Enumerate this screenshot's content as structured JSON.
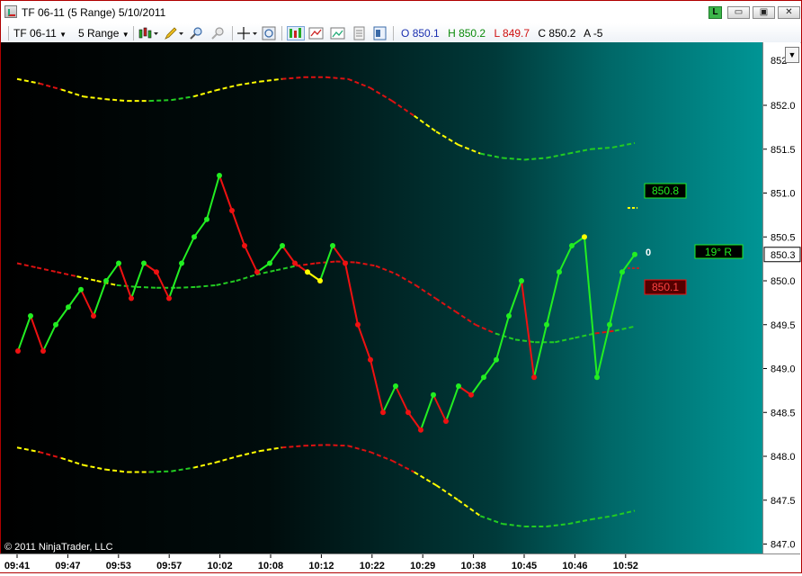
{
  "window": {
    "title": "TF 06-11 (5 Range)  5/10/2011",
    "link_label": "L",
    "minimize_glyph": "▭",
    "maximize_glyph": "▣",
    "close_glyph": "✕"
  },
  "toolbar": {
    "instrument": "TF 06-11",
    "period": "5 Range",
    "ohlc": {
      "open_label": "O",
      "open_value": "850.1",
      "high_label": "H",
      "high_value": "850.2",
      "low_label": "L",
      "low_value": "849.7",
      "close_label": "C",
      "close_value": "850.2",
      "ask_label": "A",
      "ask_value": "-5"
    },
    "icons": [
      "bar-type-icon",
      "drawing-pencil-icon",
      "zoom-in-icon",
      "zoom-out-icon",
      "crosshair-icon",
      "search-icon",
      "chart-trader-icon",
      "indicators-icon",
      "strategies-icon",
      "data-box-icon",
      "properties-icon"
    ]
  },
  "colors": {
    "up": "#22ee22",
    "down": "#ee1111",
    "neutral": "#ffff00",
    "band_up": "#22cc22",
    "band_down": "#dd1111",
    "background_left": "#000000",
    "background_right": "#008b8b"
  },
  "chart": {
    "copyright": "© 2011 NinjaTrader, LLC",
    "price_ticks": [
      "852.0",
      "851.5",
      "851.0",
      "850.5",
      "850.0",
      "849.5",
      "849.0",
      "848.5",
      "848.0",
      "847.5",
      "847.0"
    ],
    "time_ticks": [
      "09:41",
      "09:47",
      "09:53",
      "09:57",
      "10:02",
      "10:08",
      "10:12",
      "10:22",
      "10:29",
      "10:38",
      "10:45",
      "10:46",
      "10:52"
    ],
    "current_price_label": "850.3",
    "label_upper": "850.8",
    "label_lower": "850.1",
    "angle_label": "19°  R",
    "zero_label": "0",
    "top_tick_partial": "852"
  },
  "chart_data": {
    "type": "line",
    "title": "",
    "price_range": [
      846.95,
      852.5
    ],
    "closes": [
      849.2,
      849.6,
      849.2,
      849.5,
      849.7,
      849.9,
      849.6,
      850.0,
      850.2,
      849.8,
      850.2,
      850.1,
      849.8,
      850.2,
      850.5,
      850.7,
      851.2,
      850.8,
      850.4,
      850.1,
      850.2,
      850.4,
      850.2,
      850.1,
      850.0,
      850.4,
      850.2,
      849.5,
      849.1,
      848.5,
      848.8,
      848.5,
      848.3,
      848.7,
      848.4,
      848.8,
      848.7,
      848.9,
      849.1,
      849.6,
      850.0,
      848.9,
      849.5,
      850.1,
      850.4,
      850.5,
      848.9,
      849.5,
      850.1,
      850.3
    ],
    "close_colors": [
      "down",
      "up",
      "down",
      "up",
      "up",
      "up",
      "down",
      "up",
      "up",
      "down",
      "up",
      "down",
      "down",
      "up",
      "up",
      "up",
      "up",
      "down",
      "down",
      "down",
      "up",
      "up",
      "down",
      "neutral",
      "neutral",
      "up",
      "down",
      "down",
      "down",
      "down",
      "up",
      "down",
      "down",
      "up",
      "down",
      "up",
      "down",
      "up",
      "up",
      "up",
      "up",
      "down",
      "up",
      "up",
      "up",
      "neutral",
      "up",
      "up",
      "up",
      "up"
    ],
    "middle_band": [
      850.2,
      850.15,
      850.1,
      850.05,
      850.0,
      849.95,
      849.93,
      849.92,
      849.92,
      849.93,
      849.95,
      850.0,
      850.07,
      850.12,
      850.17,
      850.2,
      850.22,
      850.21,
      850.17,
      850.08,
      849.95,
      849.8,
      849.65,
      849.5,
      849.4,
      849.33,
      849.3,
      849.3,
      849.35,
      849.4,
      849.43,
      849.48
    ],
    "middle_band_colors": [
      "down",
      "down",
      "down",
      "neutral",
      "neutral",
      "up",
      "up",
      "up",
      "up",
      "up",
      "up",
      "up",
      "up",
      "up",
      "down",
      "down",
      "down",
      "down",
      "down",
      "down",
      "down",
      "down",
      "down",
      "down",
      "up",
      "up",
      "up",
      "up",
      "up",
      "down",
      "up",
      "up"
    ],
    "upper_band": [
      852.3,
      852.25,
      852.18,
      852.1,
      852.07,
      852.05,
      852.05,
      852.06,
      852.1,
      852.17,
      852.23,
      852.27,
      852.3,
      852.32,
      852.32,
      852.3,
      852.2,
      852.05,
      851.88,
      851.7,
      851.55,
      851.45,
      851.4,
      851.38,
      851.4,
      851.45,
      851.5,
      851.52,
      851.57
    ],
    "upper_band_colors": [
      "neutral",
      "down",
      "neutral",
      "neutral",
      "neutral",
      "neutral",
      "up",
      "up",
      "neutral",
      "neutral",
      "neutral",
      "neutral",
      "down",
      "down",
      "down",
      "down",
      "down",
      "down",
      "neutral",
      "neutral",
      "neutral",
      "up",
      "up",
      "up",
      "up",
      "up",
      "up",
      "up",
      "up"
    ],
    "lower_band": [
      848.1,
      848.05,
      847.98,
      847.9,
      847.85,
      847.82,
      847.82,
      847.83,
      847.87,
      847.93,
      848.0,
      848.06,
      848.1,
      848.12,
      848.13,
      848.12,
      848.05,
      847.95,
      847.82,
      847.67,
      847.5,
      847.32,
      847.23,
      847.2,
      847.2,
      847.23,
      847.28,
      847.32,
      847.38
    ],
    "lower_band_colors": [
      "neutral",
      "down",
      "neutral",
      "neutral",
      "neutral",
      "neutral",
      "up",
      "up",
      "neutral",
      "neutral",
      "neutral",
      "neutral",
      "down",
      "down",
      "down",
      "down",
      "down",
      "down",
      "neutral",
      "neutral",
      "neutral",
      "up",
      "up",
      "up",
      "up",
      "up",
      "up",
      "up",
      "up"
    ]
  }
}
